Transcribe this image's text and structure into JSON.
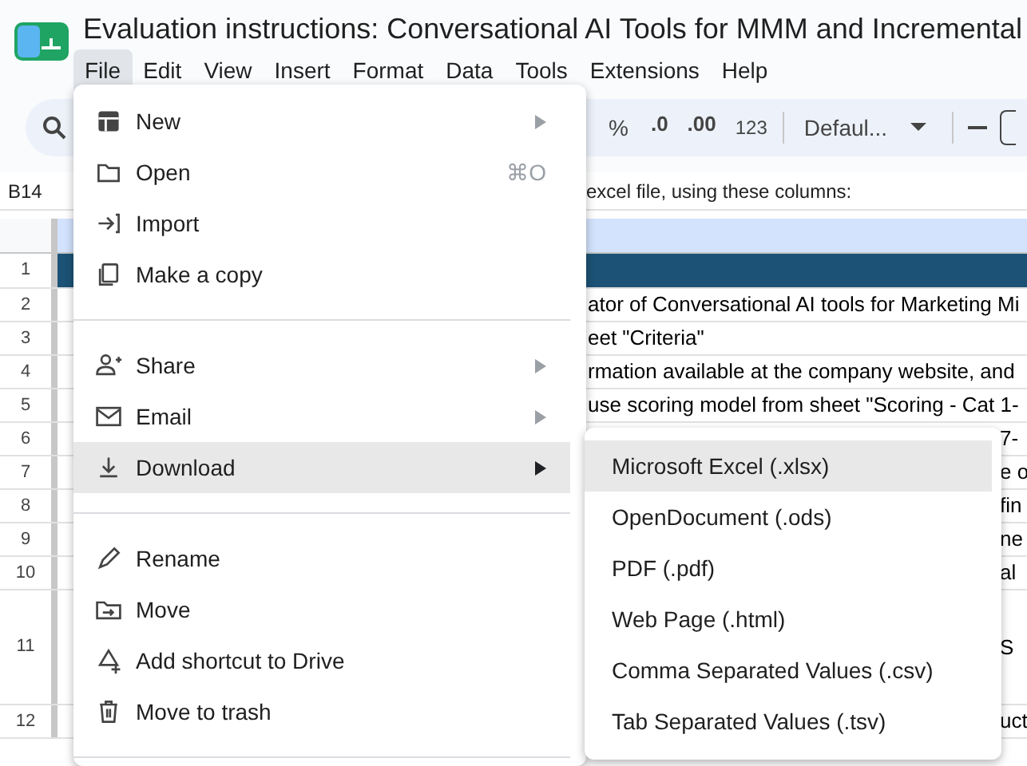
{
  "document": {
    "title": "Evaluation instructions: Conversational AI Tools for MMM and Incremental"
  },
  "menu_bar": [
    {
      "label": "File",
      "selected": true
    },
    {
      "label": "Edit",
      "selected": false
    },
    {
      "label": "View",
      "selected": false
    },
    {
      "label": "Insert",
      "selected": false
    },
    {
      "label": "Format",
      "selected": false
    },
    {
      "label": "Data",
      "selected": false
    },
    {
      "label": "Tools",
      "selected": false
    },
    {
      "label": "Extensions",
      "selected": false
    },
    {
      "label": "Help",
      "selected": false
    }
  ],
  "toolbar": {
    "percent": "%",
    "decrease_decimals": ".0",
    "increase_decimals": ".00",
    "number_format": "123",
    "font": "Defaul..."
  },
  "formula_bar": {
    "cell_ref": "B14",
    "content": "excel file, using these columns:"
  },
  "grid_rows": [
    {
      "number": "1",
      "text": ""
    },
    {
      "number": "2",
      "text": "ator of Conversational AI tools for Marketing Mi"
    },
    {
      "number": "3",
      "text": "eet \"Criteria\""
    },
    {
      "number": "4",
      "text": "rmation available at the company website, and"
    },
    {
      "number": "5",
      "text": "use scoring model from sheet \"Scoring - Cat 1-"
    },
    {
      "number": "6",
      "text": "7-"
    },
    {
      "number": "7",
      "text": "e o"
    },
    {
      "number": "8",
      "text": "fin"
    },
    {
      "number": "9",
      "text": "ne"
    },
    {
      "number": "10",
      "text": "al"
    },
    {
      "number": "11",
      "text": "S"
    },
    {
      "number": "12",
      "text": "uct"
    }
  ],
  "file_menu": [
    {
      "kind": "item",
      "label": "New",
      "has_submenu": true,
      "selected": false
    },
    {
      "kind": "item",
      "label": "Open",
      "shortcut": "⌘O",
      "has_submenu": false,
      "selected": false
    },
    {
      "kind": "item",
      "label": "Import",
      "has_submenu": false,
      "selected": false
    },
    {
      "kind": "item",
      "label": "Make a copy",
      "has_submenu": false,
      "selected": false
    },
    {
      "kind": "divider"
    },
    {
      "kind": "item",
      "label": "Share",
      "has_submenu": true,
      "selected": false
    },
    {
      "kind": "item",
      "label": "Email",
      "has_submenu": true,
      "selected": false
    },
    {
      "kind": "item",
      "label": "Download",
      "has_submenu": true,
      "selected": true
    },
    {
      "kind": "divider"
    },
    {
      "kind": "item",
      "label": "Rename",
      "has_submenu": false,
      "selected": false
    },
    {
      "kind": "item",
      "label": "Move",
      "has_submenu": false,
      "selected": false
    },
    {
      "kind": "item",
      "label": "Add shortcut to Drive",
      "has_submenu": false,
      "selected": false
    },
    {
      "kind": "item",
      "label": "Move to trash",
      "has_submenu": false,
      "selected": false
    },
    {
      "kind": "divider"
    }
  ],
  "download_submenu": [
    {
      "label": "Microsoft Excel (.xlsx)",
      "selected": true
    },
    {
      "label": "OpenDocument (.ods)",
      "selected": false
    },
    {
      "label": "PDF (.pdf)",
      "selected": false
    },
    {
      "label": "Web Page (.html)",
      "selected": false
    },
    {
      "label": "Comma Separated Values (.csv)",
      "selected": false
    },
    {
      "label": "Tab Separated Values (.tsv)",
      "selected": false
    }
  ]
}
